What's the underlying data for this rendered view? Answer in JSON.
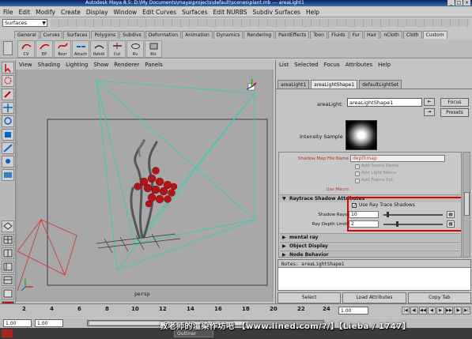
{
  "window": {
    "title": "Autodesk Maya 8.5: D:\\My Documents\\maya\\projects\\default\\scenes\\plant.mb  ---  areaLight1"
  },
  "menubar": [
    "File",
    "Edit",
    "Modify",
    "Create",
    "Display",
    "Window",
    "Edit Curves",
    "Surfaces",
    "Edit NURBS",
    "Subdiv Surfaces",
    "Help"
  ],
  "mode_select": {
    "value": "Surfaces"
  },
  "shelf_tabs": [
    "General",
    "Curves",
    "Surfaces",
    "Polygons",
    "Subdivs",
    "Deformation",
    "Animation",
    "Dynamics",
    "Rendering",
    "PaintEffects",
    "Toon",
    "Fluids",
    "Fur",
    "Hair",
    "nCloth",
    "Cloth",
    "Custom"
  ],
  "shelf_active": "Custom",
  "shelf_items": [
    "CV",
    "EP",
    "Bezr",
    "Attach",
    "Rebld",
    "Cut",
    "Rv",
    "Rls"
  ],
  "viewport": {
    "menu": [
      "View",
      "Shading",
      "Lighting",
      "Show",
      "Renderer",
      "Panels"
    ],
    "camera_label": "persp"
  },
  "attr_editor": {
    "menu": [
      "List",
      "Selected",
      "Focus",
      "Attributes",
      "Help"
    ],
    "tabs": [
      "areaLight1",
      "areaLightShape1",
      "defaultLightSet"
    ],
    "active_tab": "areaLightShape1",
    "node_label": "areaLight:",
    "node_value": "areaLightShape1",
    "focus_btn": "Focus",
    "presets_btn": "Presets",
    "intensity_label": "Intensity Sample",
    "shadow_map_label": "Shadow Map File Name",
    "shadow_map_value": "depthmap",
    "ghost_1": "Add Scene Name",
    "ghost_2": "Add Light Name",
    "ghost_3": "Add Frame Ext",
    "use_macro_label": "Use Macro",
    "raytrace_section": "Raytrace Shadow Attributes",
    "use_ray_trace_label": "Use Ray Trace Shadows",
    "use_ray_trace_checked": true,
    "shadow_rays_label": "Shadow Rays",
    "shadow_rays_value": "10",
    "ray_depth_label": "Ray Depth Limit",
    "ray_depth_value": "2",
    "sections": [
      "mental ray",
      "Object Display",
      "Node Behavior"
    ],
    "notes_label": "Notes:  areaLightShape1",
    "bottom_buttons": [
      "Select",
      "Load Attributes",
      "Copy Tab"
    ]
  },
  "timeline": {
    "ticks": [
      "2",
      "4",
      "6",
      "8",
      "10",
      "12",
      "14",
      "16",
      "18",
      "20",
      "22",
      "24"
    ],
    "current_frame": "1.00"
  },
  "range": {
    "start": "1.00",
    "start2": "1.00"
  },
  "taskbar": {
    "items": [
      "Outliner"
    ]
  },
  "watermark": "教老师的渲染作坊吧  【www.lined.com/?/】【Lieba / 1747】"
}
